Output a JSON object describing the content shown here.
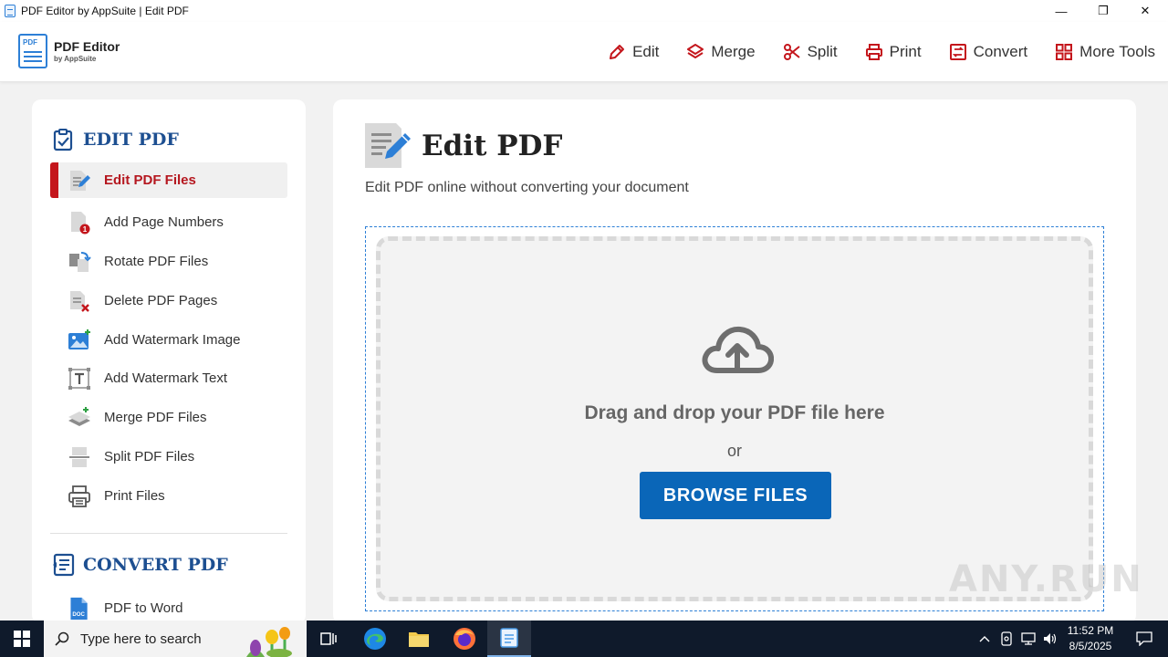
{
  "window": {
    "title": "PDF Editor by AppSuite | Edit PDF",
    "minimize_label": "—",
    "maximize_label": "❐",
    "close_label": "✕"
  },
  "brand": {
    "logo_badge": "PDF",
    "name": "PDF Editor",
    "byline": "by AppSuite",
    "accent_color": "#c4161c",
    "primary_color": "#0a66b8",
    "heading_color": "#1d4f91"
  },
  "nav": {
    "items": [
      {
        "label": "Edit",
        "icon": "pencil-icon"
      },
      {
        "label": "Merge",
        "icon": "layers-icon"
      },
      {
        "label": "Split",
        "icon": "scissors-icon"
      },
      {
        "label": "Print",
        "icon": "printer-icon"
      },
      {
        "label": "Convert",
        "icon": "convert-icon"
      },
      {
        "label": "More Tools",
        "icon": "grid-icon"
      }
    ]
  },
  "sidebar": {
    "edit_section_title": "EDIT PDF",
    "edit_items": [
      {
        "label": "Edit PDF Files",
        "icon": "edit-file-icon",
        "active": true
      },
      {
        "label": "Add Page Numbers",
        "icon": "page-number-icon"
      },
      {
        "label": "Rotate PDF Files",
        "icon": "rotate-icon"
      },
      {
        "label": "Delete PDF Pages",
        "icon": "delete-page-icon"
      },
      {
        "label": "Add Watermark Image",
        "icon": "image-watermark-icon"
      },
      {
        "label": "Add Watermark Text",
        "icon": "text-watermark-icon"
      },
      {
        "label": "Merge PDF Files",
        "icon": "merge-icon"
      },
      {
        "label": "Split PDF Files",
        "icon": "split-icon"
      },
      {
        "label": "Print Files",
        "icon": "printer-icon"
      }
    ],
    "convert_section_title": "CONVERT PDF",
    "convert_items": [
      {
        "label": "PDF to Word",
        "icon": "word-doc-icon",
        "badge": "DOC"
      }
    ]
  },
  "main": {
    "title": "Edit PDF",
    "subtitle": "Edit PDF online without converting your document",
    "drop_text": "Drag and drop your PDF file here",
    "or_text": "or",
    "browse_label": "BROWSE FILES"
  },
  "watermark": "ANY.RUN",
  "taskbar": {
    "search_placeholder": "Type here to search",
    "time": "11:52 PM",
    "date": "8/5/2025"
  }
}
